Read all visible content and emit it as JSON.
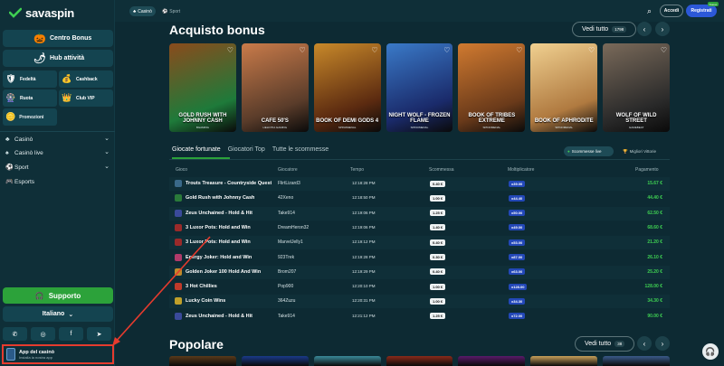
{
  "brand": {
    "name": "savaspin"
  },
  "topbar": {
    "tabs": [
      {
        "label": "Casinò"
      },
      {
        "label": "Sport"
      }
    ],
    "login_label": "Accedi",
    "register_label": "Registrati",
    "register_badge": "Nuovo"
  },
  "sidebar": {
    "centro_bonus": "Centro Bonus",
    "hub_attivita": "Hub attività",
    "grid": [
      {
        "label": "Fedeltà",
        "icon": "shield-icon"
      },
      {
        "label": "Cashback",
        "icon": "chest-icon"
      },
      {
        "label": "Ruota",
        "icon": "wheel-icon"
      },
      {
        "label": "Club VIP",
        "icon": "crown-icon"
      }
    ],
    "promozioni": "Promozioni",
    "nav": [
      {
        "label": "Casinò",
        "icon": "casino-icon",
        "has_chevron": true
      },
      {
        "label": "Casinò live",
        "icon": "live-casino-icon",
        "has_chevron": true
      },
      {
        "label": "Sport",
        "icon": "sport-icon",
        "has_chevron": true
      },
      {
        "label": "Esports",
        "icon": "esports-icon",
        "has_chevron": false
      }
    ],
    "support_label": "Supporto",
    "language_label": "Italiano",
    "app_title": "App del casinò",
    "app_subtitle": "Installa la nostra app"
  },
  "bonus_section": {
    "title": "Acquisto bonus",
    "see_all_label": "Vedi tutto",
    "see_all_count": "1798",
    "games": [
      {
        "title": "GOLD RUSH WITH JOHNNY CASH",
        "provider": "BGAMING",
        "bg1": "#1e7a3a",
        "bg2": "#8a4b1c"
      },
      {
        "title": "CAFE 50'S",
        "provider": "HELIOTIA GAMING",
        "bg1": "#5a3c2a",
        "bg2": "#c97b4a"
      },
      {
        "title": "BOOK OF DEMI GODS 4",
        "provider": "SPINOMENAL",
        "bg1": "#5b2a10",
        "bg2": "#c8892a"
      },
      {
        "title": "NIGHT WOLF - FROZEN FLAME",
        "provider": "SPINOMENAL",
        "bg1": "#1a2a6a",
        "bg2": "#3a7ac8"
      },
      {
        "title": "BOOK OF TRIBES EXTREME",
        "provider": "SPINOMENAL",
        "bg1": "#6a3a1a",
        "bg2": "#d07a30"
      },
      {
        "title": "BOOK OF APHRODITE",
        "provider": "SPINOMENAL",
        "bg1": "#b07a40",
        "bg2": "#f0d090"
      },
      {
        "title": "WOLF OF WILD STREET",
        "provider": "GAMEBEAT",
        "bg1": "#2a2a2a",
        "bg2": "#7a6a5a"
      }
    ]
  },
  "leaderboard": {
    "tabs": [
      "Giocate fortunate",
      "Giocatori Top",
      "Tutte le scommesse"
    ],
    "filter_live": "Scommesse live",
    "filter_wins": "Migliori Vittorie",
    "columns": [
      "Gioco",
      "Giocatore",
      "Tempo",
      "Scommessa",
      "Moltiplicatore",
      "Pagamento"
    ],
    "rows": [
      {
        "game": "Trouts Treasure - Countryside Quest",
        "player": "FlirtLizard3",
        "time": "12:18:28 PM",
        "bet": "0.40 €",
        "mult": "x39.00",
        "pay": "15.67 €",
        "icon": "#3a6a8a"
      },
      {
        "game": "Gold Rush with Johnny Cash",
        "player": "42Xeno",
        "time": "12:18:50 PM",
        "bet": "1.00 €",
        "mult": "x44.40",
        "pay": "44.40 €",
        "icon": "#2a7a3a"
      },
      {
        "game": "Zeus Unchained - Hold & Hit",
        "player": "Take914",
        "time": "12:19:06 PM",
        "bet": "1.25 €",
        "mult": "x50.00",
        "pay": "62.50 €",
        "icon": "#3a4a9a"
      },
      {
        "game": "3 Luxor Pots: Hold and Win",
        "player": "DreamHeron32",
        "time": "12:19:06 PM",
        "bet": "1.40 €",
        "mult": "x49.00",
        "pay": "68.60 €",
        "icon": "#9a2a2a"
      },
      {
        "game": "3 Luxor Pots: Hold and Win",
        "player": "MarvelJelly1",
        "time": "12:19:12 PM",
        "bet": "0.40 €",
        "mult": "x53.00",
        "pay": "21.20 €",
        "icon": "#9a2a2a"
      },
      {
        "game": "Energy Joker: Hold and Win",
        "player": "923Trek",
        "time": "12:19:28 PM",
        "bet": "0.30 €",
        "mult": "x87.00",
        "pay": "26.10 €",
        "icon": "#b03a6a"
      },
      {
        "game": "Golden Joker 100 Hold And Win",
        "player": "Brom207",
        "time": "12:19:29 PM",
        "bet": "0.40 €",
        "mult": "x63.00",
        "pay": "25.20 €",
        "icon": "#c08a2a"
      },
      {
        "game": "3 Hot Chillies",
        "player": "Pop900",
        "time": "12:20:10 PM",
        "bet": "1.00 €",
        "mult": "x128.00",
        "pay": "128.00 €",
        "icon": "#c03a2a"
      },
      {
        "game": "Lucky Coin Wins",
        "player": "364Zuzu",
        "time": "12:20:31 PM",
        "bet": "1.00 €",
        "mult": "x34.30",
        "pay": "34.30 €",
        "icon": "#c0a02a"
      },
      {
        "game": "Zeus Unchained - Hold & Hit",
        "player": "Take914",
        "time": "12:21:12 PM",
        "bet": "1.25 €",
        "mult": "x72.00",
        "pay": "90.00 €",
        "icon": "#3a4a9a"
      }
    ]
  },
  "popular_section": {
    "title": "Popolare",
    "see_all_label": "Vedi tutto",
    "see_all_count": "38",
    "cards": [
      "#5a3a1a",
      "#1a3a8a",
      "#3a8a9a",
      "#8a2a1a",
      "#5a1a6a",
      "#c8a05a",
      "#3a5a8a"
    ]
  },
  "colors": {
    "accent_green": "#2ca23a",
    "register_blue": "#2c58d8",
    "annotation_red": "#e63b2e",
    "payout_green": "#3ecf52"
  }
}
